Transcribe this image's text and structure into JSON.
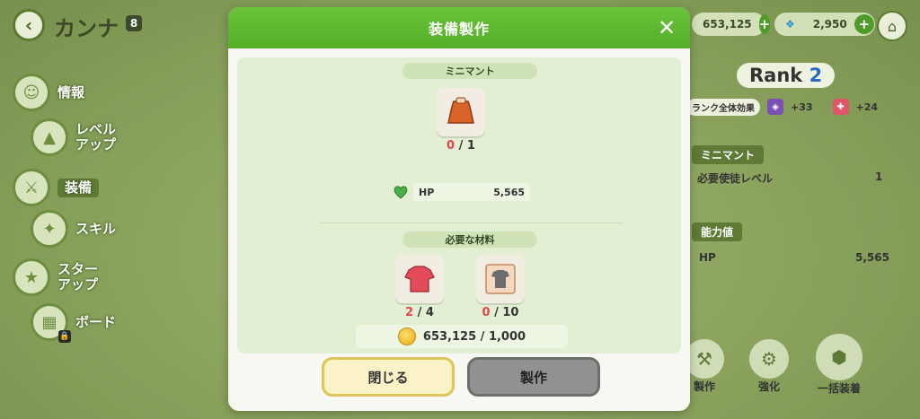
{
  "header": {
    "back_icon": "chevron-left-icon",
    "character_name": "カンナ",
    "rank_badge": "8"
  },
  "left_menu": {
    "items": [
      {
        "label": "情報",
        "icon": "profile-icon"
      },
      {
        "label": "レベル\nアップ",
        "icon": "level-up-icon"
      },
      {
        "label": "装備",
        "icon": "equipment-icon"
      },
      {
        "label": "スキル",
        "icon": "skill-icon"
      },
      {
        "label": "スター\nアップ",
        "icon": "star-up-icon"
      },
      {
        "label": "ボード",
        "icon": "board-icon"
      }
    ]
  },
  "currency": {
    "gold": "653,125",
    "gem": "2,950",
    "plus": "+"
  },
  "right_panel": {
    "rank_label": "Rank",
    "rank_value": "2",
    "bonus_label": "ランク全体効果",
    "bonus_1": "+33",
    "bonus_2": "+24",
    "item_tag": "ミニマント",
    "required_level_label": "必要使徒レベル",
    "required_level_value": "1",
    "power_tag": "能力値",
    "hp_label": "HP",
    "hp_value": "5,565",
    "actions": [
      {
        "label": "製作",
        "icon": "craft-icon"
      },
      {
        "label": "強化",
        "icon": "enhance-icon"
      },
      {
        "label": "一括装着",
        "icon": "bulk-equip-icon"
      }
    ]
  },
  "modal": {
    "title": "装備製作",
    "close_icon": "close-icon",
    "item_name": "ミニマント",
    "item_count_have": "0",
    "item_count_need": "1",
    "stat_label": "HP",
    "stat_value": "5,565",
    "materials_label": "必要な材料",
    "materials": [
      {
        "have": "2",
        "need": "4",
        "icon": "red-shirt-icon"
      },
      {
        "have": "0",
        "need": "10",
        "icon": "shirt-pattern-icon"
      }
    ],
    "gold_have": "653,125",
    "gold_need": "1,000",
    "close_button": "閉じる",
    "craft_button": "製作"
  }
}
